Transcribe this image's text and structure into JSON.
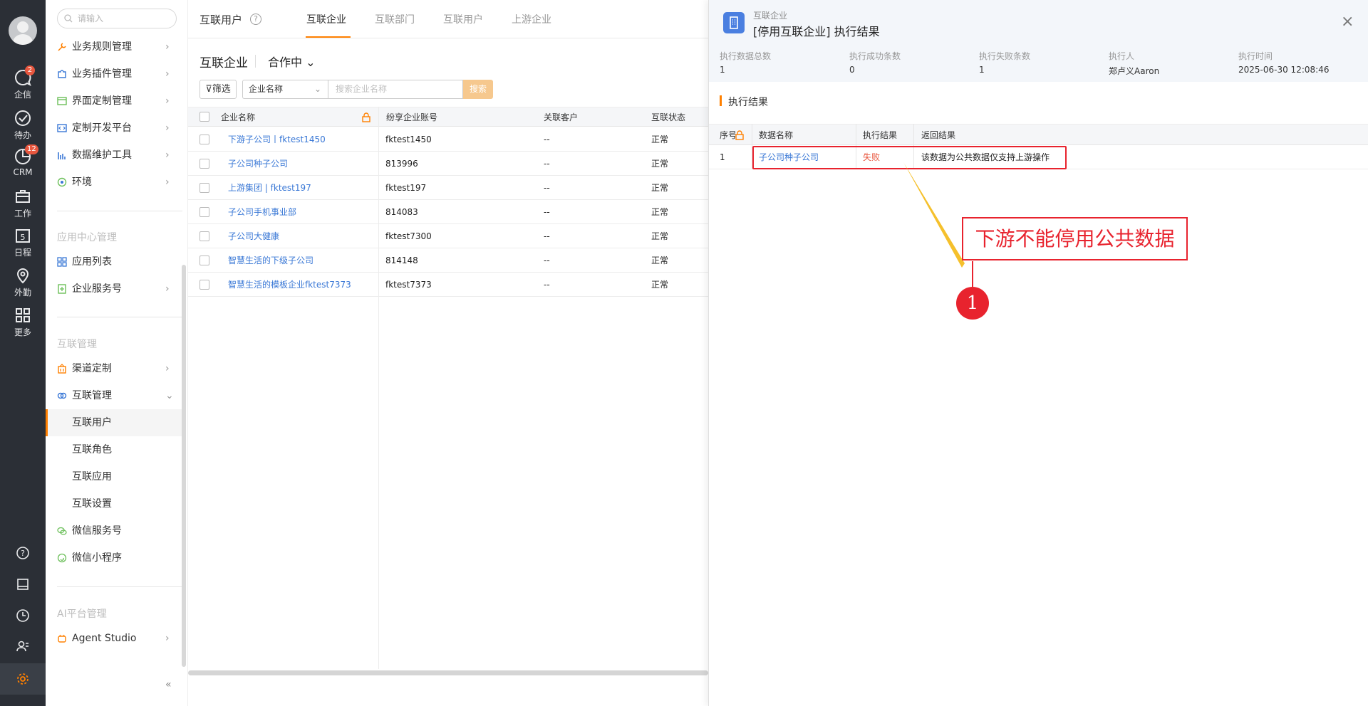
{
  "rail": {
    "items": [
      {
        "label": "企信",
        "badge": "2",
        "icon": "chat-icon"
      },
      {
        "label": "待办",
        "badge": "",
        "icon": "check-icon"
      },
      {
        "label": "CRM",
        "badge": "12",
        "icon": "pie-icon"
      },
      {
        "label": "工作",
        "badge": "",
        "icon": "briefcase-icon"
      },
      {
        "label": "日程",
        "badge": "",
        "icon": "calendar-icon",
        "day": "5"
      },
      {
        "label": "外勤",
        "badge": "",
        "icon": "location-icon"
      },
      {
        "label": "更多",
        "badge": "",
        "icon": "grid-icon"
      }
    ]
  },
  "menu": {
    "search_placeholder": "请输入",
    "items_top": [
      {
        "label": "业务规则管理"
      },
      {
        "label": "业务插件管理"
      },
      {
        "label": "界面定制管理"
      },
      {
        "label": "定制开发平台"
      },
      {
        "label": "数据维护工具"
      },
      {
        "label": "环境"
      }
    ],
    "section_app": "应用中心管理",
    "items_app": [
      {
        "label": "应用列表"
      },
      {
        "label": "企业服务号"
      }
    ],
    "section_link": "互联管理",
    "items_link": [
      {
        "label": "渠道定制"
      },
      {
        "label": "互联管理"
      }
    ],
    "subitems": [
      {
        "label": "互联用户"
      },
      {
        "label": "互联角色"
      },
      {
        "label": "互联应用"
      },
      {
        "label": "互联设置"
      }
    ],
    "items_wechat": [
      {
        "label": "微信服务号"
      },
      {
        "label": "微信小程序"
      }
    ],
    "section_ai": "AI平台管理",
    "agent_studio": "Agent Studio",
    "collapse": "«"
  },
  "main": {
    "title": "互联用户",
    "help": "?",
    "tabs": [
      {
        "label": "互联企业"
      },
      {
        "label": "互联部门"
      },
      {
        "label": "互联用户"
      },
      {
        "label": "上游企业"
      }
    ],
    "sub_title": "互联企业",
    "status": "合作中",
    "filter_label": "筛选",
    "field_select": "企业名称",
    "keyword_placeholder": "搜索企业名称",
    "search_label": "搜索",
    "columns": [
      "企业名称",
      "纷享企业账号",
      "关联客户",
      "互联状态"
    ],
    "rows": [
      {
        "name": "下游子公司丨fktest1450",
        "account": "fktest1450",
        "customer": "--",
        "status": "正常"
      },
      {
        "name": "子公司种子公司",
        "account": "813996",
        "customer": "--",
        "status": "正常"
      },
      {
        "name": "上游集团 | fktest197",
        "account": "fktest197",
        "customer": "--",
        "status": "正常"
      },
      {
        "name": "子公司手机事业部",
        "account": "814083",
        "customer": "--",
        "status": "正常"
      },
      {
        "name": "子公司大健康",
        "account": "fktest7300",
        "customer": "--",
        "status": "正常"
      },
      {
        "name": "智慧生活的下级子公司",
        "account": "814148",
        "customer": "--",
        "status": "正常"
      },
      {
        "name": "智慧生活的模板企业fktest7373",
        "account": "fktest7373",
        "customer": "--",
        "status": "正常"
      }
    ]
  },
  "drawer": {
    "small_title": "互联企业",
    "title": "[停用互联企业] 执行结果",
    "close": "×",
    "stats": [
      {
        "label": "执行数据总数",
        "value": "1"
      },
      {
        "label": "执行成功条数",
        "value": "0"
      },
      {
        "label": "执行失败条数",
        "value": "1"
      },
      {
        "label": "执行人",
        "value": "郑卢义Aaron"
      },
      {
        "label": "执行时间",
        "value": "2025-06-30 12:08:46"
      }
    ],
    "section_title": "执行结果",
    "columns": [
      "序号",
      "数据名称",
      "执行结果",
      "返回结果"
    ],
    "rows": [
      {
        "index": "1",
        "name": "子公司种子公司",
        "result": "失败",
        "message": "该数据为公共数据仅支持上游操作"
      }
    ],
    "callout": "下游不能停用公共数据",
    "marker": "1"
  },
  "colors": {
    "accent": "#ff8000",
    "link": "#3a78d6",
    "error": "#e8573f",
    "annotation": "#e8232e",
    "rail_bg": "#2b2f36"
  }
}
